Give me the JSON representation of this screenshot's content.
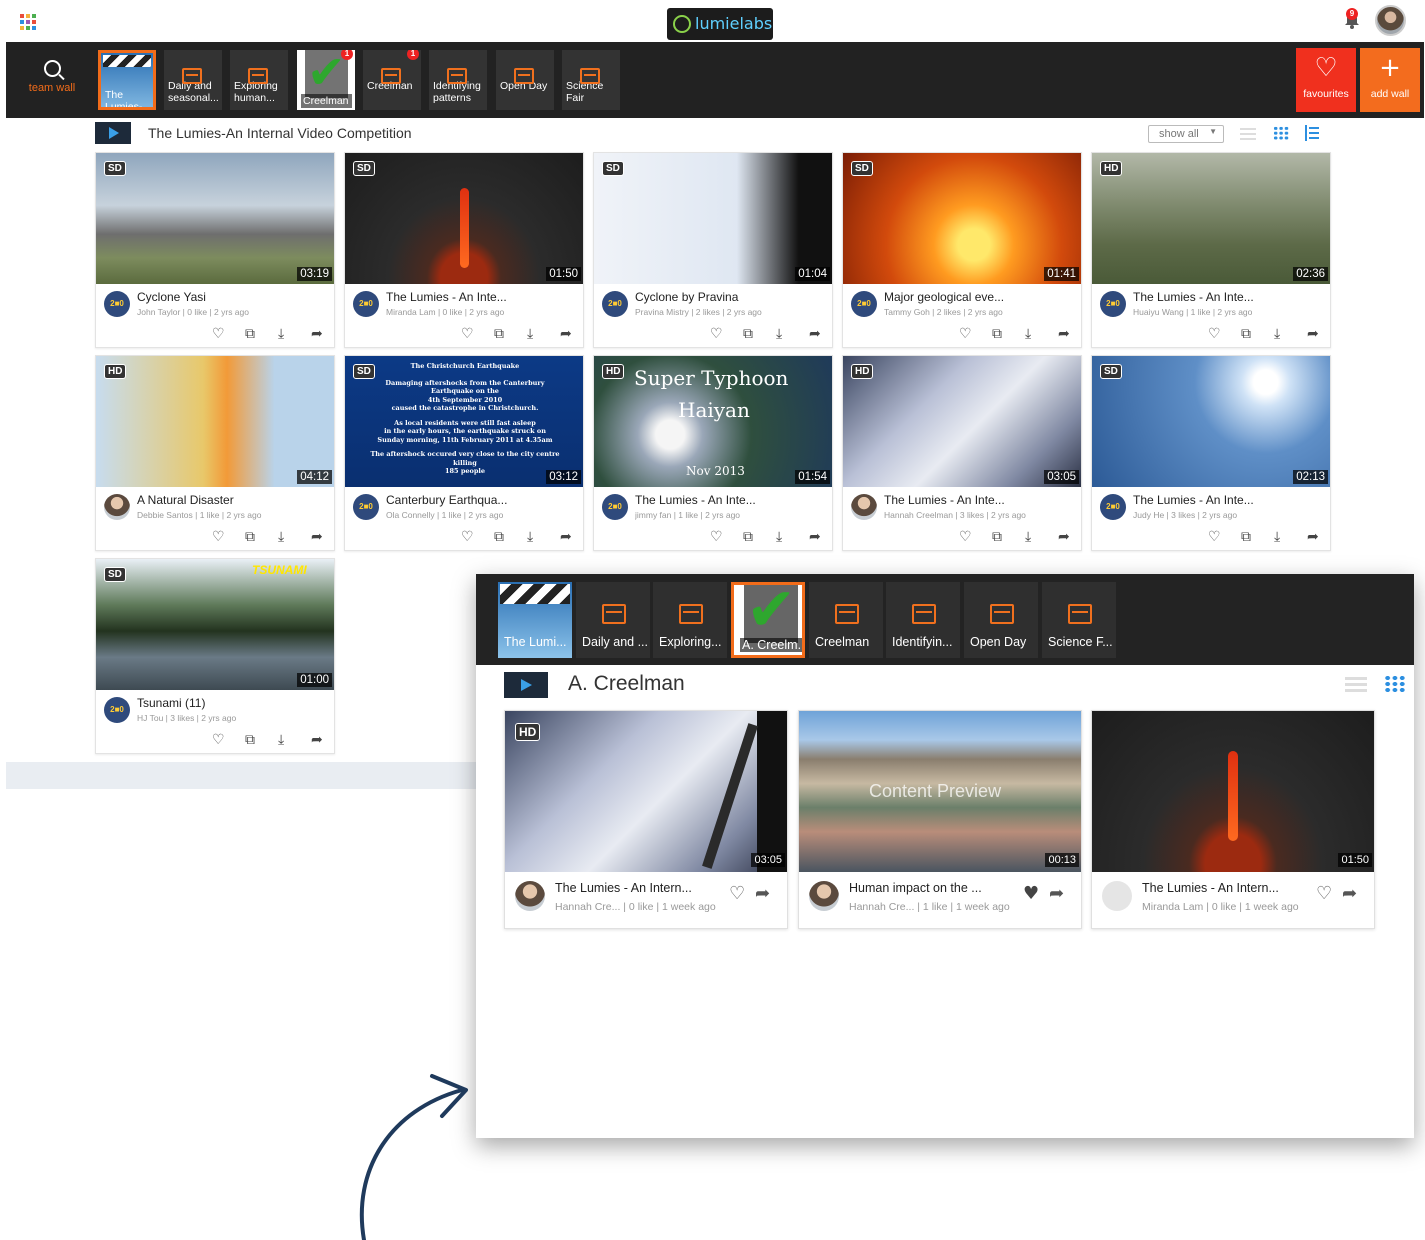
{
  "header": {
    "logo_text": "lumielabs",
    "notification_count": "9",
    "apps_colors": [
      "#e94e3c",
      "#f3b33d",
      "#4caf50",
      "#2c8fe0",
      "#9b59b6",
      "#e94e3c",
      "#f3b33d",
      "#4caf50",
      "#2c8fe0"
    ]
  },
  "nav": {
    "team_wall_label": "team wall",
    "tiles": [
      {
        "label": "The Lumies-A...",
        "kind": "thumb"
      },
      {
        "label": "Daily and seasonal...",
        "kind": "icon"
      },
      {
        "label": "Exploring human...",
        "kind": "icon"
      },
      {
        "label": "Creelman",
        "kind": "check",
        "badge": "1"
      },
      {
        "label": "Creelman",
        "kind": "icon",
        "badge": "1"
      },
      {
        "label": "Identifying patterns",
        "kind": "icon"
      },
      {
        "label": "Open Day",
        "kind": "icon"
      },
      {
        "label": "Science Fair",
        "kind": "icon"
      }
    ],
    "favourites_label": "favourites",
    "add_wall_label": "add wall",
    "colors": {
      "accent": "#f26c1a",
      "favourites_bg": "#f0301e",
      "add_wall_bg": "#f36c1e"
    }
  },
  "section": {
    "title": "The Lumies-An Internal Video Competition",
    "filter_value": "show all"
  },
  "cards": [
    {
      "quality": "SD",
      "duration": "03:19",
      "title": "Cyclone Yasi",
      "meta": "John Taylor | 0 like | 2 yrs ago",
      "avatar": "badge",
      "avatar_text": "2■0"
    },
    {
      "quality": "SD",
      "duration": "01:50",
      "title": "The Lumies - An Inte...",
      "meta": "Miranda Lam | 0 like | 2 yrs ago",
      "avatar": "badge",
      "avatar_text": "2■0"
    },
    {
      "quality": "SD",
      "duration": "01:04",
      "title": "Cyclone by Pravina",
      "meta": "Pravina Mistry | 2 likes | 2 yrs ago",
      "avatar": "badge",
      "avatar_text": "2■0"
    },
    {
      "quality": "SD",
      "duration": "01:41",
      "title": "Major geological eve...",
      "meta": "Tammy Goh | 2 likes | 2 yrs ago",
      "avatar": "badge",
      "avatar_text": "2■0"
    },
    {
      "quality": "HD",
      "duration": "02:36",
      "title": "The Lumies - An Inte...",
      "meta": "Huaiyu Wang | 1 like | 2 yrs ago",
      "avatar": "badge",
      "avatar_text": "2■0"
    },
    {
      "quality": "HD",
      "duration": "04:12",
      "title": "A Natural Disaster",
      "meta": "Debbie Santos | 1 like | 2 yrs ago",
      "avatar": "person",
      "avatar_text": ""
    },
    {
      "quality": "SD",
      "duration": "03:12",
      "title": "Canterbury Earthqua...",
      "meta": "Ola Connelly | 1 like | 2 yrs ago",
      "avatar": "badge",
      "avatar_text": "2■0"
    },
    {
      "quality": "HD",
      "duration": "01:54",
      "title": "The Lumies - An Inte...",
      "meta": "jimmy fan | 1 like | 2 yrs ago",
      "avatar": "badge",
      "avatar_text": "2■0"
    },
    {
      "quality": "HD",
      "duration": "03:05",
      "title": "The Lumies - An Inte...",
      "meta": "Hannah Creelman | 3 likes | 2 yrs ago",
      "avatar": "person",
      "avatar_text": ""
    },
    {
      "quality": "SD",
      "duration": "02:13",
      "title": "The Lumies - An Inte...",
      "meta": "Judy He | 3 likes | 2 yrs ago",
      "avatar": "badge",
      "avatar_text": "2■0"
    },
    {
      "quality": "SD",
      "duration": "01:00",
      "title": "Tsunami (11)",
      "meta": "HJ Tou | 3 likes | 2 yrs ago",
      "avatar": "badge",
      "avatar_text": "2■0"
    }
  ],
  "thumb_texts": {
    "canterbury_heading": "The Christchurch Earthquake",
    "canterbury_lines": [
      "Damaging aftershocks from the Canterbury Earthquake on the",
      "4th September 2010",
      "caused the catastrophe in Christchurch.",
      "As local residents were still fast asleep",
      "in the early hours, the earthquake struck on",
      "Sunday morning, 11th February 2011 at 4.35am",
      "The aftershock occured very close to the city centre killing",
      "185 people"
    ],
    "typhoon_title_1": "Super Typhoon",
    "typhoon_title_2": "Haiyan",
    "typhoon_date": "Nov 2013",
    "tsunami_caption": "TSUNAMI"
  },
  "overlay": {
    "tiles": [
      {
        "label": "The Lumi...",
        "kind": "thumb"
      },
      {
        "label": "Daily and ...",
        "kind": "icon"
      },
      {
        "label": "Exploring...",
        "kind": "icon"
      },
      {
        "label": "A. Creelm...",
        "kind": "check"
      },
      {
        "label": "Creelman",
        "kind": "icon"
      },
      {
        "label": "Identifyin...",
        "kind": "icon"
      },
      {
        "label": "Open Day",
        "kind": "icon"
      },
      {
        "label": "Science F...",
        "kind": "icon"
      }
    ],
    "title": "A. Creelman",
    "cards": [
      {
        "quality": "HD",
        "duration": "03:05",
        "title": "The Lumies - An Intern...",
        "meta": "Hannah Cre...  | 0 like | 1 week ago",
        "liked": false
      },
      {
        "quality": "",
        "duration": "00:13",
        "title": "Human impact on the ...",
        "meta": "Hannah Cre...  | 1 like | 1 week ago",
        "liked": true,
        "preview_label": "Content Preview"
      },
      {
        "quality": "",
        "duration": "01:50",
        "title": "The Lumies - An Intern...",
        "meta": "Miranda Lam  | 0 like | 1 week ago",
        "liked": false
      }
    ]
  }
}
